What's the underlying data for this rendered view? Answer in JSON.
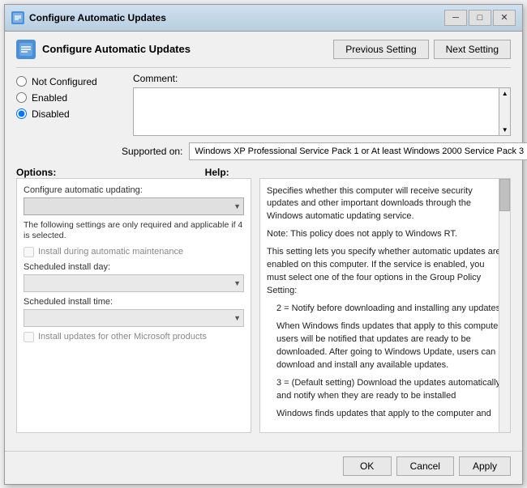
{
  "window": {
    "title": "Configure Automatic Updates",
    "icon": "⚙"
  },
  "title_controls": {
    "minimize": "─",
    "maximize": "□",
    "close": "✕"
  },
  "header": {
    "title": "Configure Automatic Updates",
    "previous_button": "Previous Setting",
    "next_button": "Next Setting"
  },
  "config": {
    "comment_label": "Comment:",
    "supported_label": "Supported on:",
    "supported_value": "Windows XP Professional Service Pack 1 or At least Windows 2000 Service Pack 3",
    "radio_options": [
      {
        "id": "not-configured",
        "label": "Not Configured",
        "checked": false
      },
      {
        "id": "enabled",
        "label": "Enabled",
        "checked": false
      },
      {
        "id": "disabled",
        "label": "Disabled",
        "checked": true
      }
    ]
  },
  "options": {
    "title": "Options:",
    "configure_label": "Configure automatic updating:",
    "dropdown_placeholder": "",
    "note": "The following settings are only required and applicable if 4 is selected.",
    "install_maintenance_label": "Install during automatic maintenance",
    "scheduled_day_label": "Scheduled install day:",
    "scheduled_time_label": "Scheduled install time:",
    "other_products_label": "Install updates for other Microsoft products"
  },
  "help": {
    "title": "Help:",
    "paragraphs": [
      "Specifies whether this computer will receive security updates and other important downloads through the Windows automatic updating service.",
      "Note: This policy does not apply to Windows RT.",
      "This setting lets you specify whether automatic updates are enabled on this computer. If the service is enabled, you must select one of the four options in the Group Policy Setting:",
      "2 = Notify before downloading and installing any updates.",
      "When Windows finds updates that apply to this computer, users will be notified that updates are ready to be downloaded. After going to Windows Update, users can download and install any available updates.",
      "3 = (Default setting) Download the updates automatically and notify when they are ready to be installed",
      "Windows finds updates that apply to the computer and"
    ]
  },
  "footer": {
    "ok_label": "OK",
    "cancel_label": "Cancel",
    "apply_label": "Apply"
  }
}
